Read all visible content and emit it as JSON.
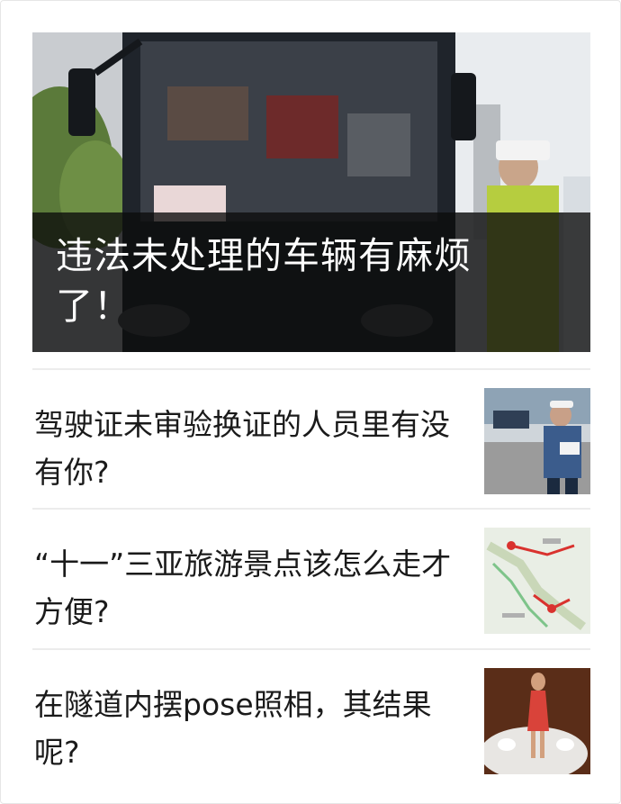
{
  "cover": {
    "title": "违法未处理的车辆有麻烦了！",
    "image_icon": "bus-police-photo"
  },
  "items": [
    {
      "title": "驾驶证未审验换证的人员里有没有你?",
      "thumb_icon": "traffic-police-photo"
    },
    {
      "title": "“十一”三亚旅游景点该怎么走才方便?",
      "thumb_icon": "route-map-photo"
    },
    {
      "title": "在隧道内摆pose照相，其结果呢?",
      "thumb_icon": "woman-car-photo"
    }
  ]
}
